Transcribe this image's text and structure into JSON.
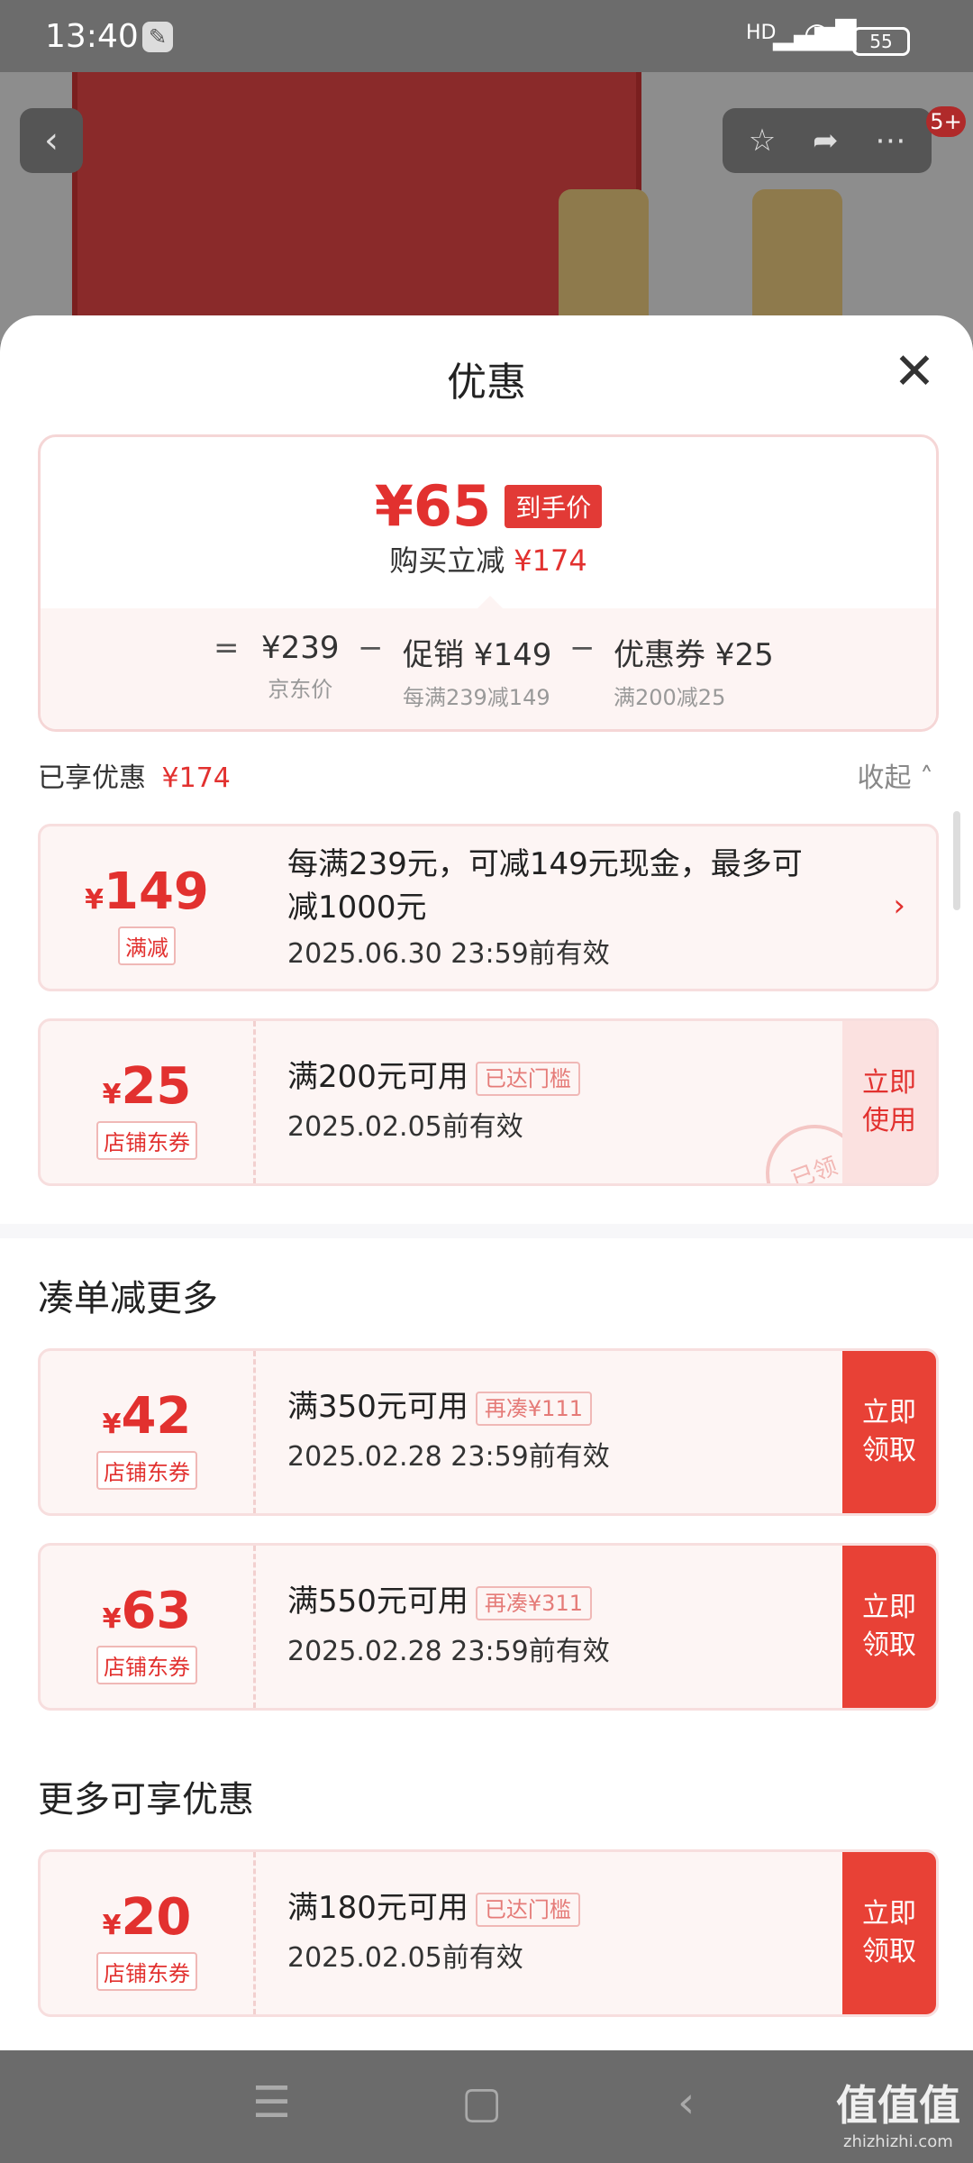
{
  "status": {
    "time": "13:40",
    "signal": "HD",
    "battery": "55"
  },
  "top": {
    "badge": "5+"
  },
  "sheet": {
    "title": "优惠"
  },
  "price": {
    "amount": "¥65",
    "tag": "到手价",
    "savings_label": "购买立减",
    "savings_amount": "¥174",
    "breakdown": [
      {
        "main": "¥239",
        "sub": "京东价"
      },
      {
        "main": "促销 ¥149",
        "sub": "每满239减149"
      },
      {
        "main": "优惠券 ¥25",
        "sub": "满200减25"
      }
    ]
  },
  "enjoyed": {
    "label": "已享优惠",
    "amount": "¥174",
    "collapse": "收起"
  },
  "coupons": [
    {
      "yen": "¥",
      "num": "149",
      "tag": "满减",
      "title": "每满239元，可减149元现金，最多可减1000元",
      "date": "2025.06.30 23:59前有效"
    },
    {
      "yen": "¥",
      "num": "25",
      "tag": "店铺东券",
      "title": "满200元可用",
      "cond": "已达门槛",
      "date": "2025.02.05前有效",
      "btn": "立即使用",
      "stamp": "已领"
    }
  ],
  "section2": {
    "title": "凑单减更多",
    "coupons": [
      {
        "yen": "¥",
        "num": "42",
        "tag": "店铺东券",
        "title": "满350元可用",
        "cond": "再凑¥111",
        "date": "2025.02.28 23:59前有效",
        "btn": "立即领取"
      },
      {
        "yen": "¥",
        "num": "63",
        "tag": "店铺东券",
        "title": "满550元可用",
        "cond": "再凑¥311",
        "date": "2025.02.28 23:59前有效",
        "btn": "立即领取"
      }
    ]
  },
  "section3": {
    "title": "更多可享优惠",
    "coupons": [
      {
        "yen": "¥",
        "num": "20",
        "tag": "店铺东券",
        "title": "满180元可用",
        "cond": "已达门槛",
        "date": "2025.02.05前有效",
        "btn": "立即领取"
      }
    ]
  },
  "watermark": {
    "main": "值值值",
    "sub": "zhizhizhi.com"
  },
  "colors": {
    "accent": "#e2312f",
    "button": "#e84136",
    "coupon_bg": "#fdf5f4"
  }
}
